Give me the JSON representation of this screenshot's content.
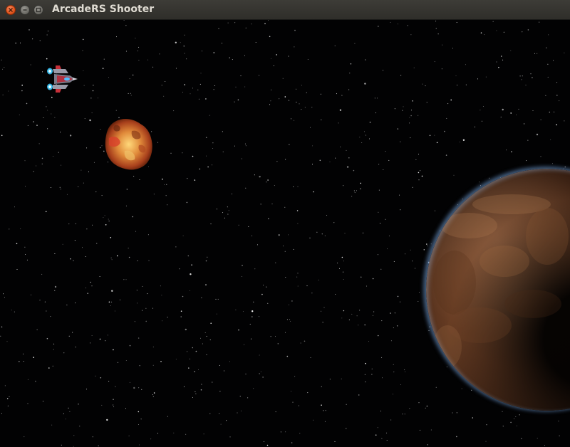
{
  "window": {
    "title": "ArcadeRS Shooter"
  },
  "window_controls": [
    "close",
    "minimize",
    "maximize"
  ],
  "colors": {
    "background": "#020203",
    "planet": "#8a5a3a",
    "planet_rim": "#78aae6",
    "asteroid": "#e07a3a",
    "ship_thruster": "#38c8ff"
  },
  "game_objects": [
    {
      "kind": "player-ship"
    },
    {
      "kind": "asteroid"
    },
    {
      "kind": "planet"
    }
  ]
}
